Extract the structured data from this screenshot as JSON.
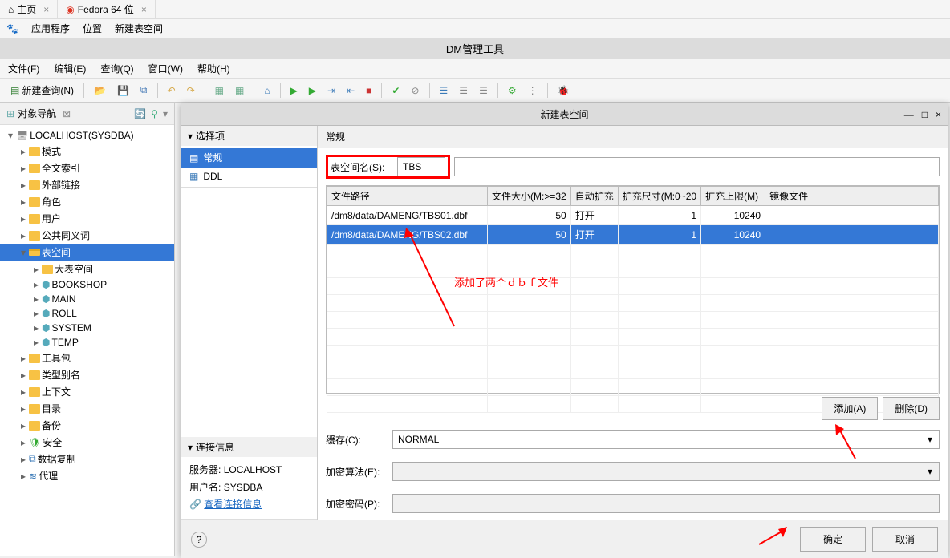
{
  "top_tabs": {
    "home": "主页",
    "fedora": "Fedora 64 位"
  },
  "app_menu": {
    "apps": "应用程序",
    "location": "位置",
    "new_ts": "新建表空间"
  },
  "title": "DM管理工具",
  "menu": {
    "file": "文件(F)",
    "edit": "编辑(E)",
    "query": "查询(Q)",
    "window": "窗口(W)",
    "help": "帮助(H)"
  },
  "toolbar": {
    "new_query": "新建查询(N)"
  },
  "nav": {
    "title": "对象导航",
    "root": "LOCALHOST(SYSDBA)",
    "items": [
      "模式",
      "全文索引",
      "外部链接",
      "角色",
      "用户",
      "公共同义词",
      "表空间"
    ],
    "ts_children": [
      "大表空间",
      "BOOKSHOP",
      "MAIN",
      "ROLL",
      "SYSTEM",
      "TEMP"
    ],
    "after": [
      "工具包",
      "类型别名",
      "上下文",
      "目录",
      "备份",
      "安全",
      "数据复制",
      "代理"
    ]
  },
  "dialog": {
    "title": "新建表空间",
    "side_hdr": "选择项",
    "opt_general": "常规",
    "opt_ddl": "DDL",
    "conn_hdr": "连接信息",
    "server_lbl": "服务器:",
    "server": "LOCALHOST",
    "user_lbl": "用户名:",
    "user": "SYSDBA",
    "view_conn": "查看连接信息",
    "panel_title": "常规",
    "ts_name_lbl": "表空间名(S):",
    "ts_name": "TBS",
    "cols": {
      "path": "文件路径",
      "size": "文件大小(M:>=32",
      "auto": "自动扩充",
      "step": "扩充尺寸(M:0~20",
      "max": "扩充上限(M)",
      "mirror": "镜像文件"
    },
    "rows": [
      {
        "path": "/dm8/data/DAMENG/TBS01.dbf",
        "size": "50",
        "auto": "打开",
        "step": "1",
        "max": "10240"
      },
      {
        "path": "/dm8/data/DAMENG/TBS02.dbf",
        "size": "50",
        "auto": "打开",
        "step": "1",
        "max": "10240"
      }
    ],
    "note": "添加了两个ｄｂｆ文件",
    "add": "添加(A)",
    "del": "删除(D)",
    "cache_lbl": "缓存(C):",
    "cache": "NORMAL",
    "enc_algo_lbl": "加密算法(E):",
    "enc_pwd_lbl": "加密密码(P):",
    "ok": "确定",
    "cancel": "取消"
  }
}
